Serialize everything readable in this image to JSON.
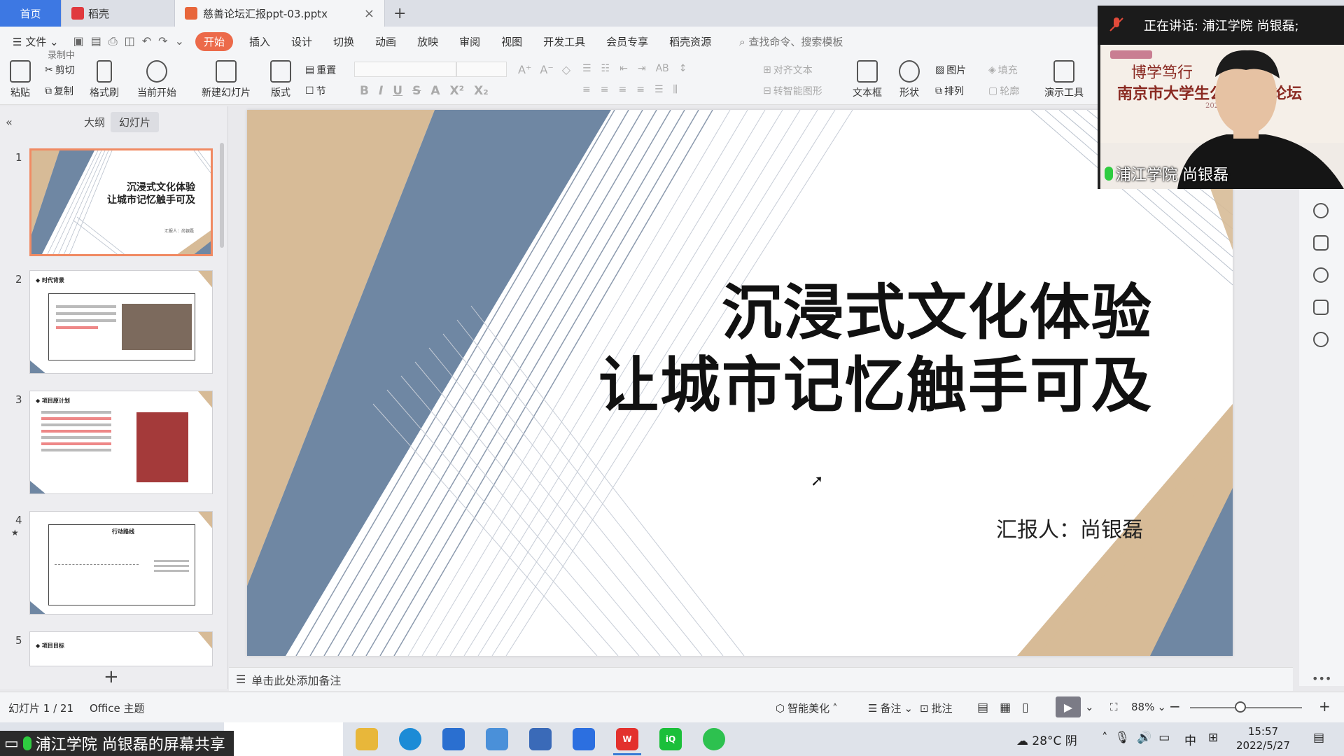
{
  "tabs": {
    "home": "首页",
    "daoke": "稻壳",
    "doc": "慈善论坛汇报ppt-03.pptx",
    "add": "+",
    "close": "×"
  },
  "menu": {
    "file": "文件",
    "items": [
      "开始",
      "插入",
      "设计",
      "切换",
      "动画",
      "放映",
      "审阅",
      "视图",
      "开发工具",
      "会员专享",
      "稻壳资源"
    ],
    "search": "查找命令、搜索模板",
    "recording": "录制中"
  },
  "ribbon": {
    "paste": "粘贴",
    "cut": "剪切",
    "copy": "复制",
    "format_painter": "格式刷",
    "start_from_current": "当前开始",
    "new_slide": "新建幻灯片",
    "layout": "版式",
    "reset": "重置",
    "section": "节",
    "align_text": "对齐文本",
    "convert_smartart": "转智能图形",
    "text_box": "文本框",
    "shape": "形状",
    "picture": "图片",
    "arrange": "排列",
    "fill": "填充",
    "outline": "轮廓",
    "present_tools": "演示工具"
  },
  "left_panel": {
    "outline_tab": "大纲",
    "slides_tab": "幻灯片",
    "thumbnails": [
      {
        "num": "1",
        "title_line1": "沉浸式文化体验",
        "title_line2": "让城市记忆触手可及",
        "sub": "汇报人：尚银磊"
      },
      {
        "num": "2",
        "title": "时代背景"
      },
      {
        "num": "3",
        "title": "项目原计划"
      },
      {
        "num": "4",
        "title": "行动路线"
      },
      {
        "num": "5",
        "title": "项目目标"
      }
    ],
    "add": "+"
  },
  "slide": {
    "title_line1": "沉浸式文化体验",
    "title_line2": "让城市记忆触手可及",
    "reporter": "汇报人：尚银磊",
    "colors": {
      "slate": "#6f87a3",
      "tan": "#d7bb97"
    }
  },
  "notes": {
    "placeholder": "单击此处添加备注"
  },
  "status": {
    "slide_counter": "幻灯片 1 / 21",
    "theme": "Office 主题",
    "beautify": "智能美化",
    "notes": "备注",
    "comments": "批注",
    "zoom": "88%"
  },
  "video": {
    "speaking": "正在讲话: 浦江学院 尚银磊;",
    "name": "浦江学院 尚银磊",
    "banner_line1": "博学笃行",
    "banner_line2": "南京市大学生公益发展论坛",
    "banner_year": "2022"
  },
  "taskbar": {
    "share_label": "浦江学院 尚银磊的屏幕共享",
    "weather": "28°C 阴",
    "ime": "中",
    "time": "15:57",
    "date": "2022/5/27"
  }
}
